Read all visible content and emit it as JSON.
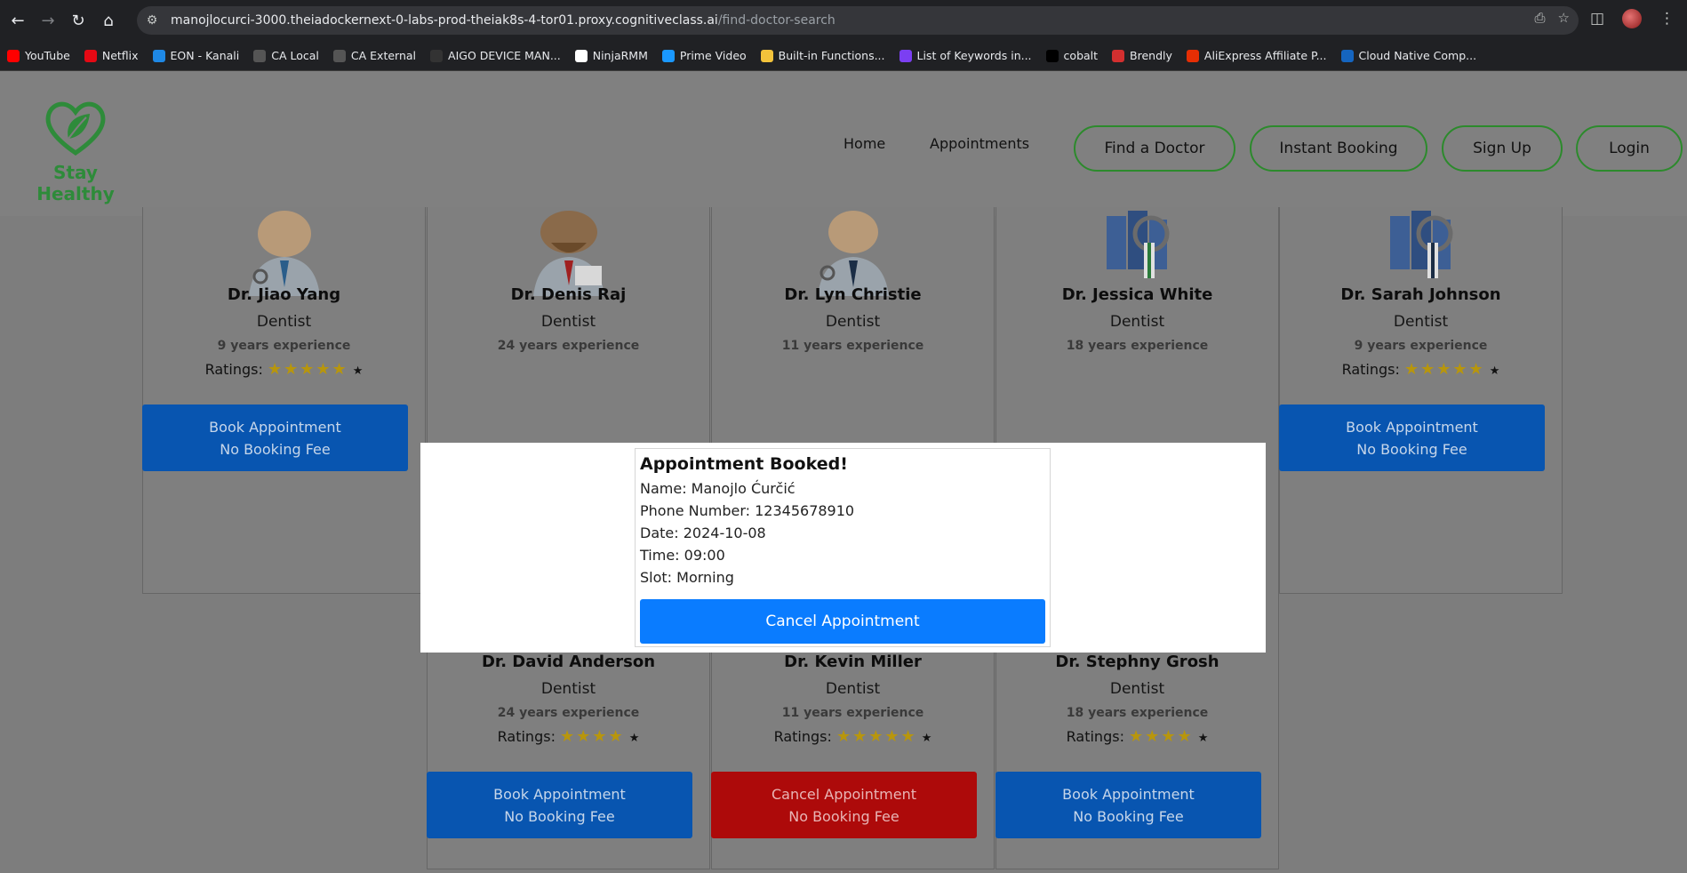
{
  "browser": {
    "url_host": "manojlocurci-3000.theiadockernext-0-labs-prod-theiak8s-4-tor01.proxy.cognitiveclass.ai",
    "url_path": "/find-doctor-search",
    "bookmarks": [
      {
        "label": "YouTube",
        "color": "#ff0000"
      },
      {
        "label": "Netflix",
        "color": "#e50914"
      },
      {
        "label": "EON - Kanali",
        "color": "#1e88e5"
      },
      {
        "label": "CA Local",
        "color": "#555555"
      },
      {
        "label": "CA External",
        "color": "#555555"
      },
      {
        "label": "AIGO DEVICE MAN...",
        "color": "#333333"
      },
      {
        "label": "NinjaRMM",
        "color": "#ffffff"
      },
      {
        "label": "Prime Video",
        "color": "#1a98ff"
      },
      {
        "label": "Built-in Functions...",
        "color": "#f3c33b"
      },
      {
        "label": "List of Keywords in...",
        "color": "#7b3ff2"
      },
      {
        "label": "cobalt",
        "color": "#000000"
      },
      {
        "label": "Brendly",
        "color": "#d32f2f"
      },
      {
        "label": "AliExpress Affiliate P...",
        "color": "#e62e04"
      },
      {
        "label": "Cloud Native Comp...",
        "color": "#1565c0"
      }
    ]
  },
  "header": {
    "brand": "Stay Healthy",
    "nav_home": "Home",
    "nav_appointments": "Appointments",
    "btn_find_doctor": "Find a Doctor",
    "btn_instant_booking": "Instant Booking",
    "btn_sign_up": "Sign Up",
    "btn_login": "Login"
  },
  "doctors_row1": [
    {
      "name": "Dr. Jiao Yang",
      "speciality": "Dentist",
      "experience": "9 years experience",
      "ratings_label": "Ratings:",
      "stars": 5,
      "button_line1": "Book Appointment",
      "button_line2": "No Booking Fee"
    },
    {
      "name": "Dr. Denis Raj",
      "speciality": "Dentist",
      "experience": "24 years experience"
    },
    {
      "name": "Dr. Lyn Christie",
      "speciality": "Dentist",
      "experience": "11 years experience"
    },
    {
      "name": "Dr. Jessica White",
      "speciality": "Dentist",
      "experience": "18 years experience"
    },
    {
      "name": "Dr. Sarah Johnson",
      "speciality": "Dentist",
      "experience": "9 years experience",
      "ratings_label": "Ratings:",
      "stars": 5,
      "button_line1": "Book Appointment",
      "button_line2": "No Booking Fee"
    }
  ],
  "doctors_row2": [
    {
      "name": "Dr. David Anderson",
      "speciality": "Dentist",
      "experience": "24 years experience",
      "ratings_label": "Ratings:",
      "stars": 4,
      "button_line1": "Book Appointment",
      "button_line2": "No Booking Fee"
    },
    {
      "name": "Dr. Kevin Miller",
      "speciality": "Dentist",
      "experience": "11 years experience",
      "ratings_label": "Ratings:",
      "stars": 5,
      "button_line1": "Cancel Appointment",
      "button_line2": "No Booking Fee"
    },
    {
      "name": "Dr. Stephny Grosh",
      "speciality": "Dentist",
      "experience": "18 years experience",
      "ratings_label": "Ratings:",
      "stars": 4,
      "button_line1": "Book Appointment",
      "button_line2": "No Booking Fee"
    }
  ],
  "modal": {
    "title": "Appointment Booked!",
    "name_line": "Name: Manojlo Ćurčić",
    "phone_line": "Phone Number: 12345678910",
    "date_line": "Date: 2024-10-08",
    "time_line": "Time: 09:00",
    "slot_line": "Slot: Morning",
    "cancel_label": "Cancel Appointment"
  },
  "colors": {
    "brand_green": "#2e8b3a",
    "book_blue": "#0855b0",
    "cancel_red": "#ad0a0a",
    "modal_button_blue": "#0a7cff"
  }
}
